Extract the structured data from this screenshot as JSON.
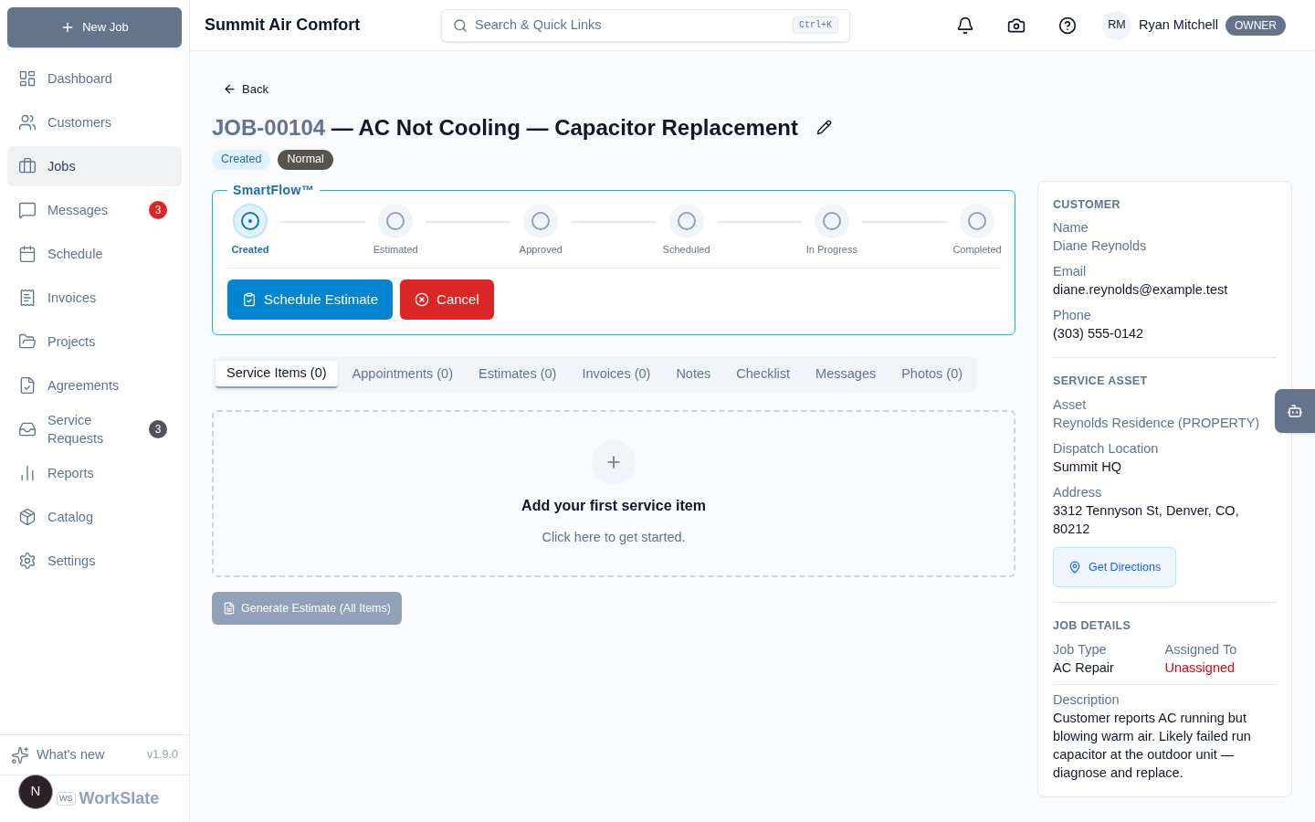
{
  "sidebar": {
    "new_button": "New Job",
    "items": [
      {
        "label": "Dashboard",
        "selected": false
      },
      {
        "label": "Customers",
        "selected": false
      },
      {
        "label": "Jobs",
        "selected": true
      },
      {
        "label": "Messages",
        "selected": false,
        "badge": {
          "text": "3",
          "color": "#dc2626"
        }
      },
      {
        "label": "Schedule",
        "selected": false
      },
      {
        "label": "Invoices",
        "selected": false
      },
      {
        "label": "Projects",
        "selected": false
      },
      {
        "label": "Agreements",
        "selected": false
      },
      {
        "label": "Service Requests",
        "selected": false,
        "badge": {
          "text": "3",
          "color": "#52525b"
        }
      },
      {
        "label": "Reports",
        "selected": false
      },
      {
        "label": "Catalog",
        "selected": false
      },
      {
        "label": "Settings",
        "selected": false
      }
    ],
    "whats_new": "What's new",
    "version": "v1.9.0",
    "avatar": "N",
    "brand_mark": "WS",
    "brand": "WorkSlate"
  },
  "header": {
    "company": "Summit Air Comfort",
    "search": {
      "placeholder": "Search & Quick Links",
      "shortcut": "Ctrl+K"
    },
    "user": {
      "initials": "RM",
      "name": "Ryan Mitchell",
      "role": "OWNER"
    }
  },
  "back": "Back",
  "job": {
    "number": "JOB-00104",
    "title": "— AC Not Cooling — Capacitor Replacement",
    "tags": [
      {
        "label": "Created",
        "kind": "status"
      },
      {
        "label": "Normal",
        "kind": "priority"
      }
    ]
  },
  "smartflow": {
    "title": "SmartFlow™",
    "steps": [
      {
        "label": "Created",
        "selected": true
      },
      {
        "label": "Estimated",
        "selected": false
      },
      {
        "label": "Approved",
        "selected": false
      },
      {
        "label": "Scheduled",
        "selected": false
      },
      {
        "label": "In Progress",
        "selected": false
      },
      {
        "label": "Completed",
        "selected": false
      }
    ],
    "actions": [
      {
        "label": "Schedule Estimate",
        "kind": "primary"
      },
      {
        "label": "Cancel",
        "kind": "danger"
      }
    ]
  },
  "tabs": [
    {
      "label": "Service Items (0)",
      "selected": true
    },
    {
      "label": "Appointments (0)",
      "selected": false
    },
    {
      "label": "Estimates (0)",
      "selected": false
    },
    {
      "label": "Invoices (0)",
      "selected": false
    },
    {
      "label": "Notes",
      "selected": false
    },
    {
      "label": "Checklist",
      "selected": false
    },
    {
      "label": "Messages",
      "selected": false
    },
    {
      "label": "Photos (0)",
      "selected": false
    }
  ],
  "empty_state": {
    "title": "Add your first service item",
    "subtitle": "Click here to get started."
  },
  "generate_button": {
    "label": "Generate Estimate (All Items)",
    "disabled": true
  },
  "details": {
    "sections": [
      {
        "heading": "CUSTOMER",
        "fields": [
          {
            "label": "Name",
            "value": "Diane Reynolds",
            "kind": "muted"
          },
          {
            "label": "Email",
            "value": "diane.reynolds@example.test",
            "kind": "plain"
          },
          {
            "label": "Phone",
            "value": "(303) 555-0142",
            "kind": "plain"
          }
        ]
      },
      {
        "heading": "SERVICE ASSET",
        "fields": [
          {
            "label": "Asset",
            "value": "Reynolds Residence (PROPERTY)",
            "kind": "muted"
          },
          {
            "label": "Dispatch Location",
            "value": "Summit HQ",
            "kind": "plain"
          },
          {
            "label": "Address",
            "value": "3312 Tennyson St, Denver, CO, 80212",
            "kind": "plain"
          }
        ],
        "button": "Get Directions"
      },
      {
        "heading": "JOB DETAILS",
        "columns": [
          {
            "label": "Job Type",
            "value": "AC Repair",
            "kind": "plain"
          },
          {
            "label": "Assigned To",
            "value": "Unassigned",
            "kind": "alert"
          }
        ],
        "fields": [
          {
            "label": "Description",
            "value": "Customer reports AC running but blowing warm air. Likely failed run capacitor at the outdoor unit — diagnose and replace.",
            "kind": "plain"
          }
        ]
      }
    ]
  }
}
